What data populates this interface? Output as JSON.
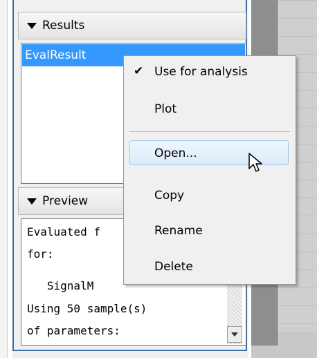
{
  "results_panel": {
    "header_label": "Results",
    "items": [
      {
        "label": "EvalResult",
        "selected": true
      }
    ]
  },
  "preview_panel": {
    "header_label": "Preview",
    "lines": [
      "Evaluated f",
      "for:",
      "   SignalM",
      "Using 50 sample(s)",
      "of parameters:"
    ]
  },
  "context_menu": {
    "items": [
      {
        "label": "Use for analysis",
        "checked": true
      },
      {
        "label": "Plot",
        "checked": false
      },
      {
        "label": "Open...",
        "checked": false,
        "hovered": true
      },
      {
        "label": "Copy",
        "checked": false
      },
      {
        "label": "Rename",
        "checked": false
      },
      {
        "label": "Delete",
        "checked": false
      }
    ],
    "check_glyph": "✔"
  },
  "icons": {
    "header_toggle": "triangle-down-icon",
    "cursor": "mouse-pointer-icon",
    "scroll_down": "scroll-down-arrow-icon"
  },
  "colors": {
    "selection": "#3399ff",
    "panel_border": "#3a6ea5",
    "menu_hover": "#dcebfb"
  }
}
